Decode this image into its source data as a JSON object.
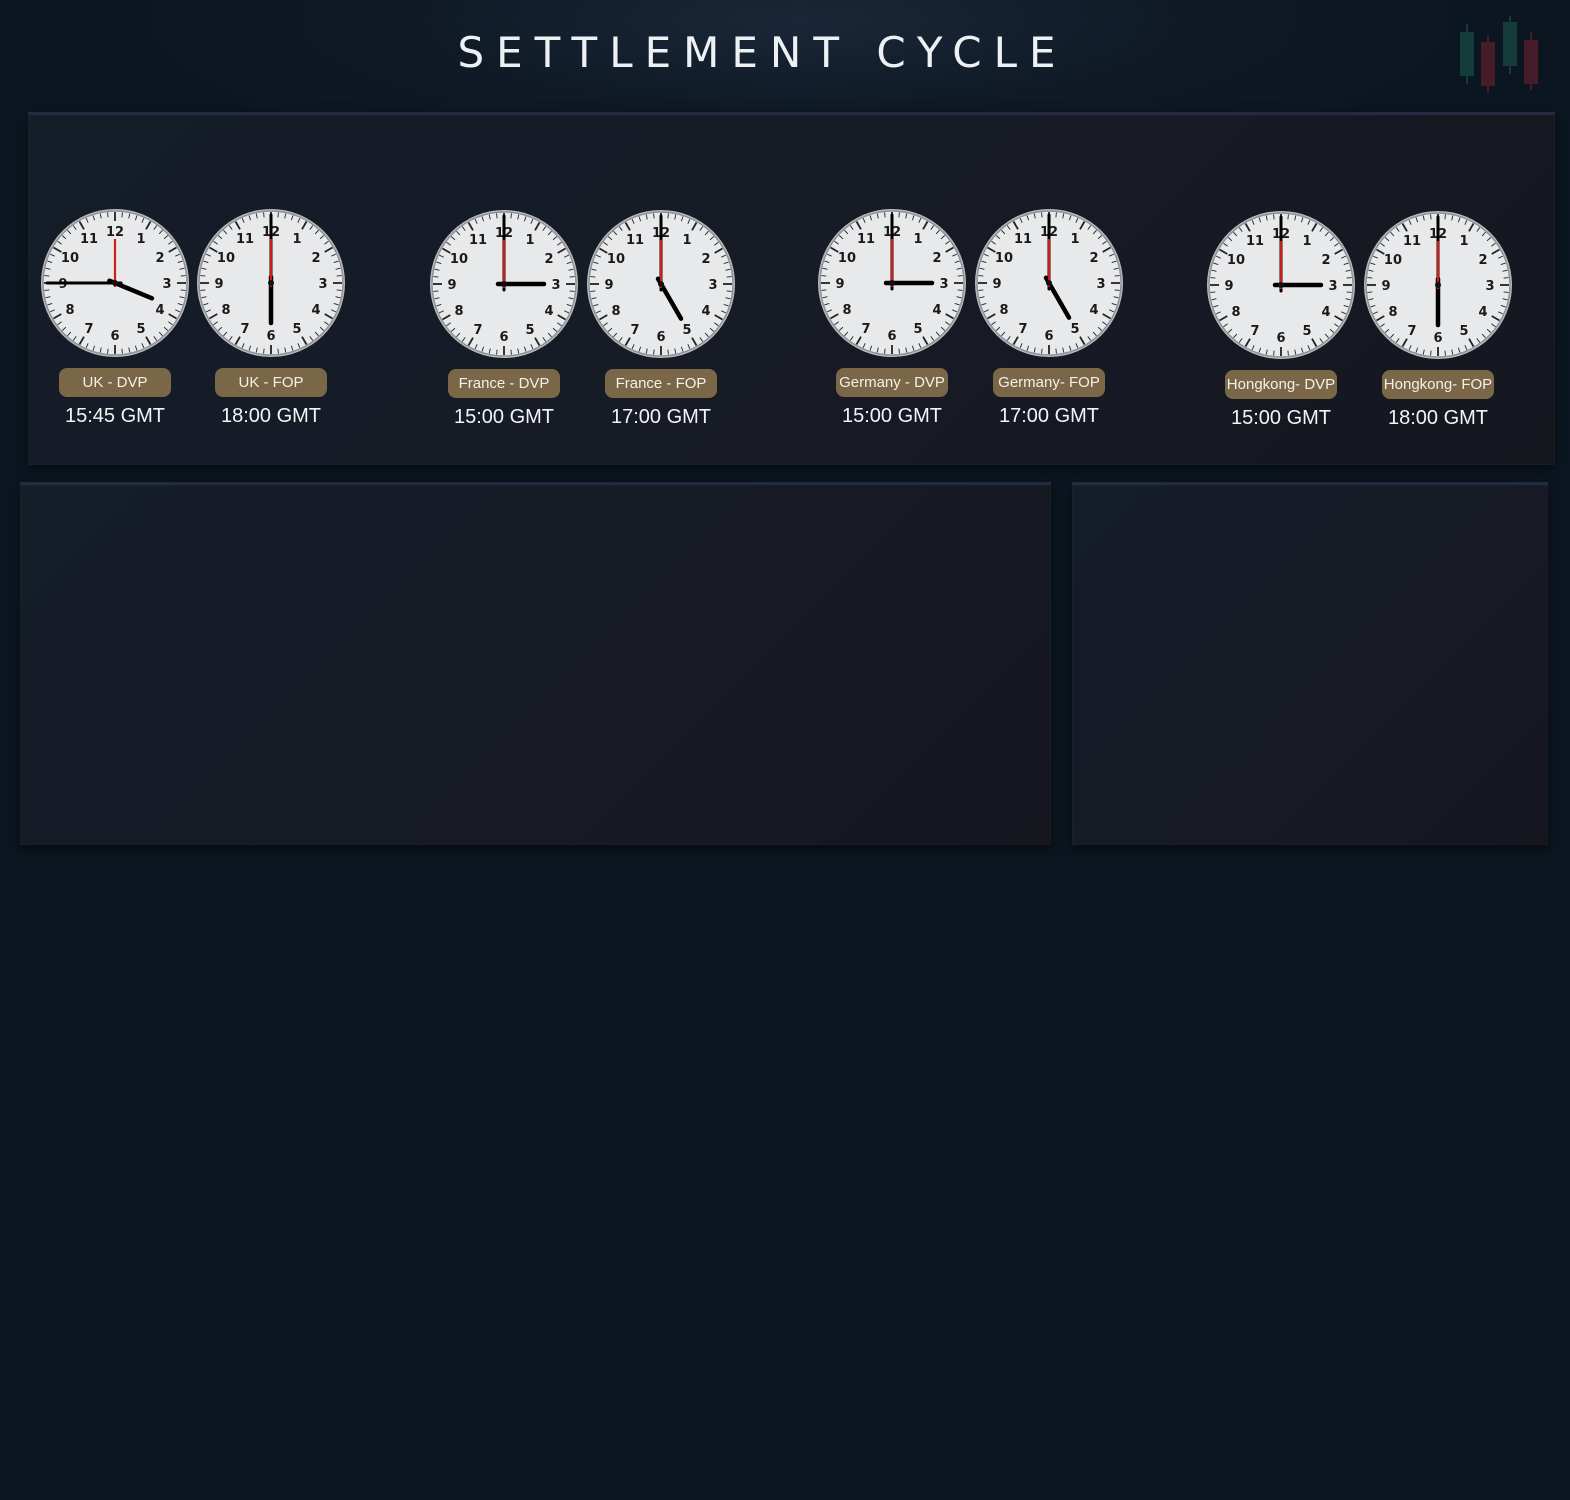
{
  "header": {
    "title": "SETTLEMENT CYCLE",
    "logo_icon": "candlestick-chart-icon"
  },
  "colors": {
    "background": "#0d1722",
    "panel": "#161b26",
    "label_bg": "#7a6748",
    "clock_face": "#e8e9eb",
    "second_hand": "#d11a1a",
    "candle_green": "#1f6e5a",
    "candle_red": "#8a2430"
  },
  "clocks": [
    {
      "label": "UK - DVP",
      "time_text": "15:45 GMT",
      "hours": 15,
      "minutes": 45
    },
    {
      "label": "UK - FOP",
      "time_text": "18:00 GMT",
      "hours": 18,
      "minutes": 0
    },
    {
      "label": "France - DVP",
      "time_text": "15:00 GMT",
      "hours": 15,
      "minutes": 0
    },
    {
      "label": "France - FOP",
      "time_text": "17:00 GMT",
      "hours": 17,
      "minutes": 0
    },
    {
      "label": "Germany - DVP",
      "time_text": "15:00 GMT",
      "hours": 15,
      "minutes": 0
    },
    {
      "label": "Germany- FOP",
      "time_text": "17:00 GMT",
      "hours": 17,
      "minutes": 0
    },
    {
      "label": "Hongkong- DVP",
      "time_text": "15:00 GMT",
      "hours": 15,
      "minutes": 0
    },
    {
      "label": "Hongkong- FOP",
      "time_text": "18:00 GMT",
      "hours": 18,
      "minutes": 0
    }
  ]
}
